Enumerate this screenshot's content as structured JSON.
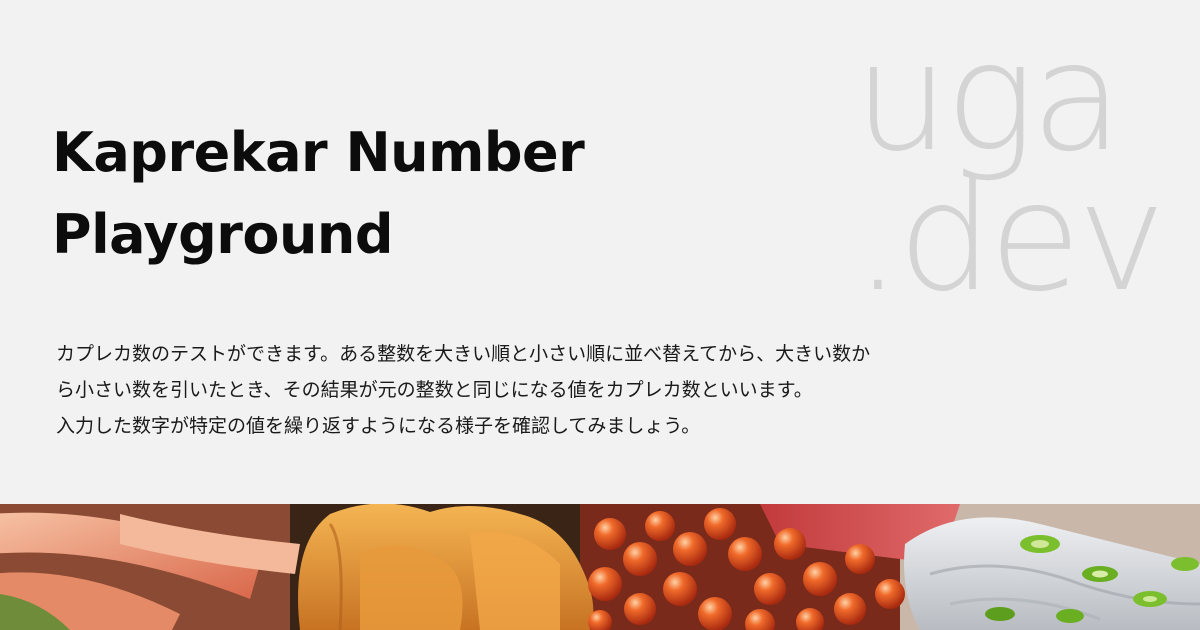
{
  "title": {
    "line1": "Kaprekar Number",
    "line2": "Playground"
  },
  "brand": {
    "line1": "uga",
    "line2": ".dev"
  },
  "description": {
    "line1": "カプレカ数のテストができます。ある整数を大きい順と小さい順に並べ替えてから、大きい数か",
    "line2": "ら小さい数を引いたとき、その結果が元の整数と同じになる値をカプレカ数といいます。",
    "line3": "入力した数字が特定の値を繰り返すようになる様子を確認してみましょう。"
  },
  "colors": {
    "background": "#f2f2f2",
    "title": "#0c0c0c",
    "brand": "#d4d4d4"
  }
}
